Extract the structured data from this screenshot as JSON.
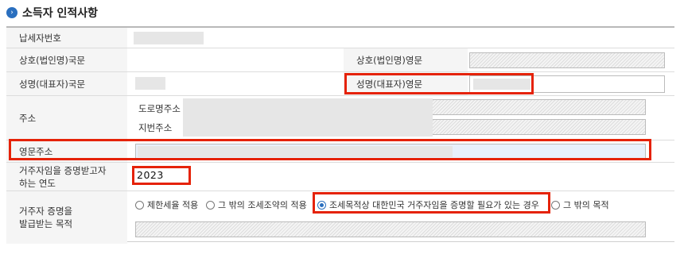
{
  "section": {
    "title": "소득자 인적사항"
  },
  "rows": {
    "tax_id": {
      "label": "납세자번호"
    },
    "company": {
      "label_kr": "상호(법인명)국문",
      "label_en": "상호(법인명)영문"
    },
    "name": {
      "label_kr": "성명(대표자)국문",
      "label_en": "성명(대표자)영문"
    },
    "address": {
      "label": "주소",
      "road_label": "도로명주소",
      "lot_label": "지번주소"
    },
    "eng_address": {
      "label": "영문주소"
    },
    "year": {
      "label_line1": "거주자임을 증명받고자",
      "label_line2": "하는 연도",
      "value": "2023"
    },
    "purpose": {
      "label_line1": "거주자 증명을",
      "label_line2": "발급받는 목적",
      "options": [
        {
          "label": "제한세율 적용",
          "selected": false
        },
        {
          "label": "그 밖의 조세조약의 적용",
          "selected": false
        },
        {
          "label": "조세목적상 대한민국 거주자임을 증명할 필요가 있는 경우",
          "selected": true
        },
        {
          "label": "그 밖의 목적",
          "selected": false
        }
      ]
    }
  },
  "colors": {
    "highlight": "#e52207",
    "accent": "#2a6fbf"
  }
}
